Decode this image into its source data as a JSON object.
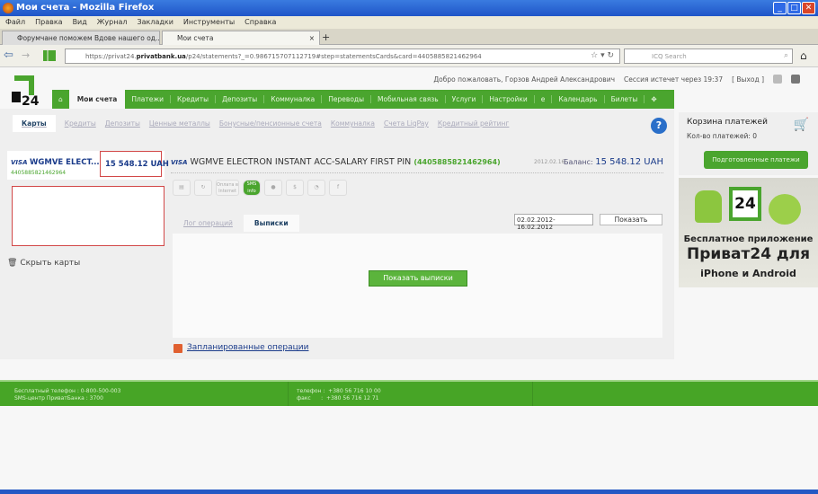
{
  "window": {
    "title": "Мои счета - Mozilla Firefox"
  },
  "menu": [
    "Файл",
    "Правка",
    "Вид",
    "Журнал",
    "Закладки",
    "Инструменты",
    "Справка"
  ],
  "tabs": [
    {
      "label": "Форумчане поможем Вдове нашего од..."
    },
    {
      "label": "Мои счета"
    }
  ],
  "url": {
    "prefix": "https://privat24.",
    "host": "privatbank.ua",
    "rest": "/p24/statements?_=0.986715707112719#step=statementsCards&card=4405885821462964"
  },
  "search": {
    "placeholder": "ICQ Search"
  },
  "header": {
    "welcome": "Добро пожаловать, Горзов Андрей Александрович",
    "session": "Сессия истечет через 19:37",
    "logout": "[ Выход ]",
    "logo": "24"
  },
  "mainnav": [
    "Мои счета",
    "Платежи",
    "Кредиты",
    "Депозиты",
    "Коммуналка",
    "Переводы",
    "Мобильная связь",
    "Услуги",
    "Настройки",
    "е",
    "Календарь",
    "Билеты"
  ],
  "subtabs": [
    "Карты",
    "Кредиты",
    "Депозиты",
    "Ценные металлы",
    "Бонусные/пенсионные счета",
    "Коммуналка",
    "Счета LiqPay",
    "Кредитный рейтинг"
  ],
  "card": {
    "brand": "VISA",
    "short_name": "WGMVE ELECT...",
    "number": "4405885821462964",
    "balance": "15 548.12 UAH",
    "full_name": "WGMVE ELECTRON INSTANT ACC-SALARY FIRST PIN",
    "number_paren": "(4405885821462964)",
    "date": "2012.02.16",
    "balance_label": "Баланс:"
  },
  "hide_cards": "Скрыть карты",
  "icons": [
    "Оплата в Internet",
    "SMS info"
  ],
  "op_tabs": [
    "Лог операций",
    "Выписки"
  ],
  "date_range": "02.02.2012-16.02.2012",
  "show_button": "Показать",
  "show_statements": "Показать выписки",
  "planned": "Запланированные операции",
  "cart": {
    "title": "Корзина платежей",
    "count": "Кол-во платежей: 0",
    "button": "Подготовленные платежи"
  },
  "ad": {
    "line1": "Бесплатное приложение",
    "line2": "Приват24 для",
    "line3": "iPhone и Android"
  },
  "footer": {
    "free_phone": "Бесплатный телефон : 0-800-500-003",
    "sms": "SMS-центр ПриватБанка : 3700",
    "phone": "телефон :  +380 56 716 10 00",
    "fax": "факс      :  +380 56 716 12 71"
  }
}
